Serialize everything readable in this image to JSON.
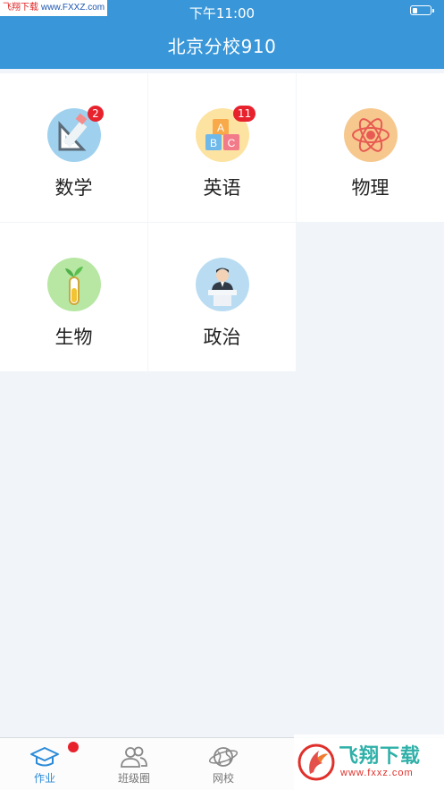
{
  "status_bar": {
    "watermark_site": "飞翔下载",
    "watermark_url": "www.FXXZ.com",
    "time": "下午11:00",
    "battery_level": 0.25
  },
  "header": {
    "title": "北京分校910"
  },
  "subjects": [
    {
      "label": "数学",
      "icon": "geometry-ruler-pencil-icon",
      "badge": "2",
      "color": "#9fd1ee"
    },
    {
      "label": "英语",
      "icon": "abc-blocks-icon",
      "badge": "11",
      "color": "#fde3a1"
    },
    {
      "label": "物理",
      "icon": "atom-icon",
      "badge": "",
      "color": "#f6c88e"
    },
    {
      "label": "生物",
      "icon": "test-tube-sprout-icon",
      "badge": "",
      "color": "#b7e7a3"
    },
    {
      "label": "政治",
      "icon": "speaker-podium-icon",
      "badge": "",
      "color": "#b9dcf2"
    }
  ],
  "tabbar": {
    "tabs": [
      {
        "label": "作业",
        "icon": "graduation-cap-icon",
        "active": true,
        "dot": true
      },
      {
        "label": "班级圈",
        "icon": "group-people-icon",
        "active": false,
        "dot": false
      },
      {
        "label": "网校",
        "icon": "globe-icon",
        "active": false,
        "dot": false
      }
    ],
    "accent": "#2b8bd8"
  },
  "watermark": {
    "brand": "飞翔下载",
    "url": "www.fxxz.com"
  },
  "colors": {
    "header": "#3997d9",
    "background": "#f1f5f9",
    "badge": "#e8222d"
  }
}
